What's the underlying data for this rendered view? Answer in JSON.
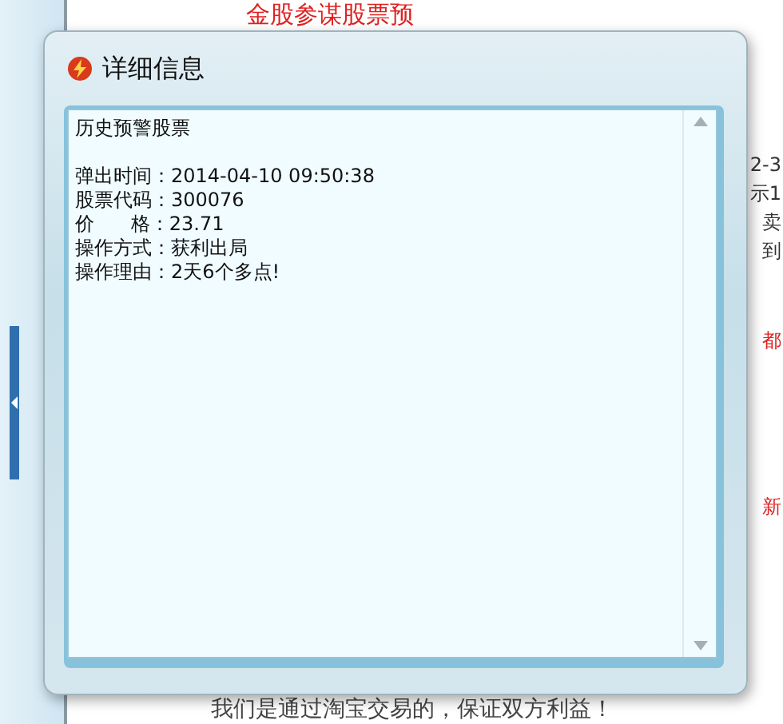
{
  "page": {
    "title": "金股参谋股票预",
    "fragments": [
      {
        "text": "2-3",
        "color": "#333333"
      },
      {
        "text": "示1",
        "color": "#333333"
      },
      {
        "text": "卖",
        "color": "#333333"
      },
      {
        "text": "到",
        "color": "#333333"
      },
      {
        "text": "都",
        "color": "#dd2222"
      },
      {
        "text": "新",
        "color": "#dd2222"
      }
    ],
    "footer": "我们是通过淘宝交易的，保证双方利益！"
  },
  "dialog": {
    "title": "详细信息",
    "heading": "历史预警股票",
    "fields": [
      {
        "label": "弹出时间：",
        "value": "2014-04-10 09:50:38"
      },
      {
        "label": "股票代码：",
        "value": "300076"
      },
      {
        "label": "价      格：",
        "value": "23.71"
      },
      {
        "label": "操作方式：",
        "value": "获利出局"
      },
      {
        "label": "操作理由：",
        "value": "2天6个多点!"
      }
    ]
  }
}
